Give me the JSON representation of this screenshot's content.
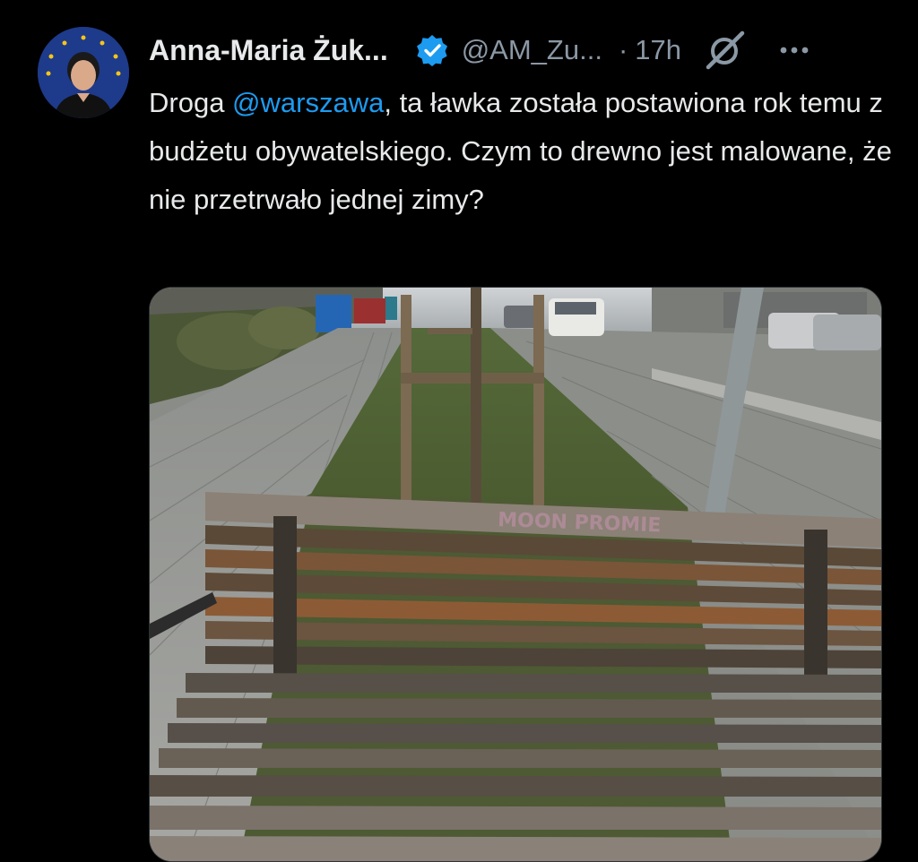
{
  "author": {
    "display_name": "Anna-Maria Żuk...",
    "handle": "@AM_Zu...",
    "separator": "·",
    "time": "17h",
    "verified": true,
    "avatar_icon": "avatar-photo"
  },
  "actions": {
    "grok_icon": "grok-icon",
    "more_icon": "more-icon"
  },
  "tweet": {
    "text_before": "Droga ",
    "mention": "@warszawa",
    "text_after": ", ta ławka została postawiona rok temu z budżetu obywatelskiego. Czym to drewno jest malowane, że nie przetrwało jednej zimy?"
  },
  "media": {
    "graffiti_text": "MOON PROMIE"
  },
  "colors": {
    "background": "#000000",
    "text": "#e7e9ea",
    "secondary": "#8b98a5",
    "link": "#1d9bf0",
    "verified": "#1d9bf0"
  }
}
